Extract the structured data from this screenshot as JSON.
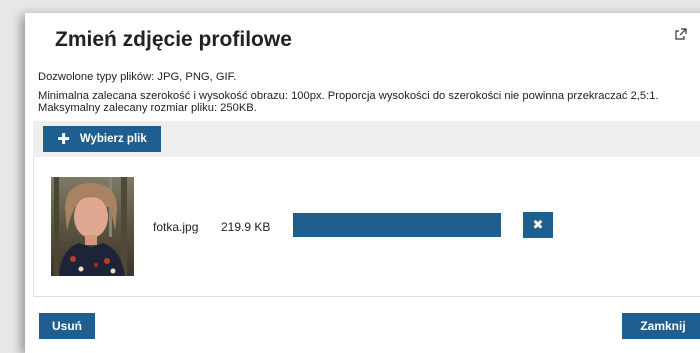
{
  "dialog": {
    "title": "Zmień zdjęcie profilowe",
    "info_types": "Dozwolone typy plików: JPG, PNG, GIF.",
    "info_dimensions": "Minimalna zalecana szerokość i wysokość obrazu: 100px. Proporcja wysokości do szerokości nie powinna przekraczać 2,5:1.",
    "info_size": "Maksymalny zalecany rozmiar pliku: 250KB."
  },
  "toolbar": {
    "choose_file_label": "Wybierz plik",
    "choose_file_icon": "plus-icon"
  },
  "file": {
    "name": "fotka.jpg",
    "size": "219.9 KB",
    "progress": 1.0,
    "remove_icon": "close-icon"
  },
  "footer": {
    "delete_label": "Usuń",
    "close_label": "Zamknij"
  },
  "colors": {
    "accent": "#1f5f8f",
    "toolbar_bg": "#eeeeee"
  }
}
